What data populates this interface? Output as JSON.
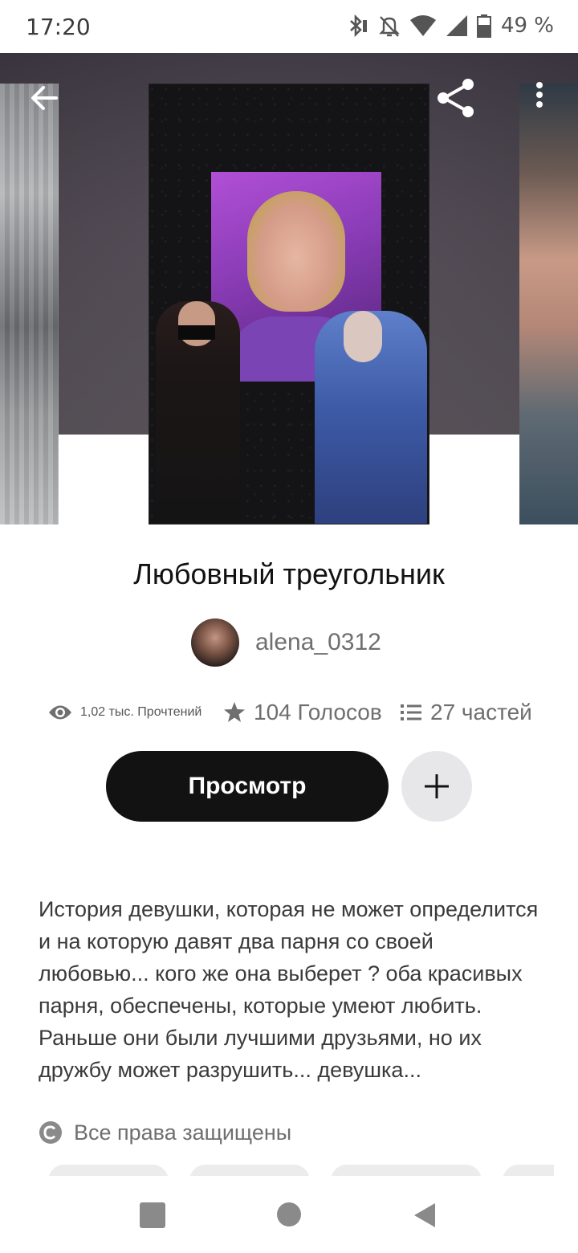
{
  "status_bar": {
    "time": "17:20",
    "battery_percent": "49 %",
    "icons": [
      "bluetooth-icon",
      "silent-icon",
      "wifi-icon",
      "signal-icon",
      "battery-icon"
    ]
  },
  "hero": {
    "icons": [
      "back-arrow-icon",
      "share-icon",
      "more-vert-icon"
    ]
  },
  "story": {
    "title": "Любовный треугольник",
    "author": "alena_0312",
    "stats": {
      "reads": "1,02 тыс. Прочтений",
      "votes": "104 Голосов",
      "parts": "27 частей"
    },
    "read_button_label": "Просмотр",
    "description": "История девушки, которая не может определится и на которую давят два парня со своей любовью... кого же она выберет ? оба красивых парня, обеспечены, которые умеют любить. Раньше они были лучшими друзьями, но  их дружбу может разрушить... девушка...",
    "rights_label": "Все права защищены"
  },
  "colors": {
    "primary_button": "#121212",
    "secondary_button": "#e7e6e8",
    "muted_text": "#6f6f6f"
  }
}
